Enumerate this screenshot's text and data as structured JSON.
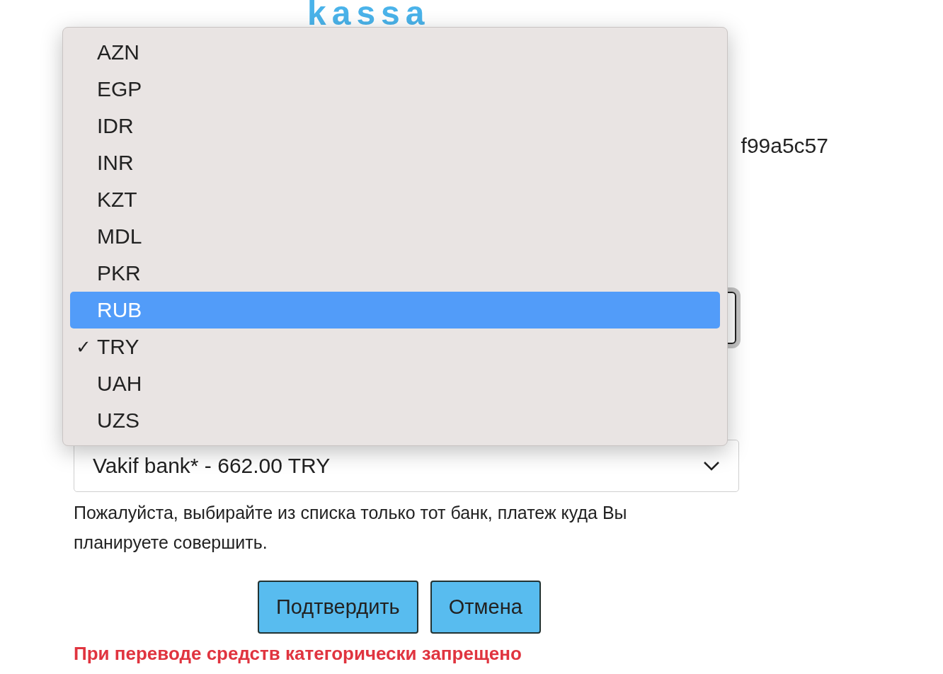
{
  "logo": {
    "text": "kassa"
  },
  "order_id": {
    "text": "f99a5c57"
  },
  "currency_select": {
    "focused": true
  },
  "bank_select": {
    "value": "Vakif bank* - 662.00 TRY"
  },
  "hint": "Пожалуйста, выбирайте из списка только тот банк, платеж куда Вы планируете совершить.",
  "buttons": [
    {
      "label": "Подтвердить"
    },
    {
      "label": "Отмена"
    }
  ],
  "warning": "При переводе средств категорически запрещено",
  "currency_menu": {
    "check_glyph": "✓",
    "options": [
      {
        "label": "AZN",
        "selected": false,
        "checked": false
      },
      {
        "label": "EGP",
        "selected": false,
        "checked": false
      },
      {
        "label": "IDR",
        "selected": false,
        "checked": false
      },
      {
        "label": "INR",
        "selected": false,
        "checked": false
      },
      {
        "label": "KZT",
        "selected": false,
        "checked": false
      },
      {
        "label": "MDL",
        "selected": false,
        "checked": false
      },
      {
        "label": "PKR",
        "selected": false,
        "checked": false
      },
      {
        "label": "RUB",
        "selected": true,
        "checked": false
      },
      {
        "label": "TRY",
        "selected": false,
        "checked": true
      },
      {
        "label": "UAH",
        "selected": false,
        "checked": false
      },
      {
        "label": "UZS",
        "selected": false,
        "checked": false
      }
    ]
  }
}
